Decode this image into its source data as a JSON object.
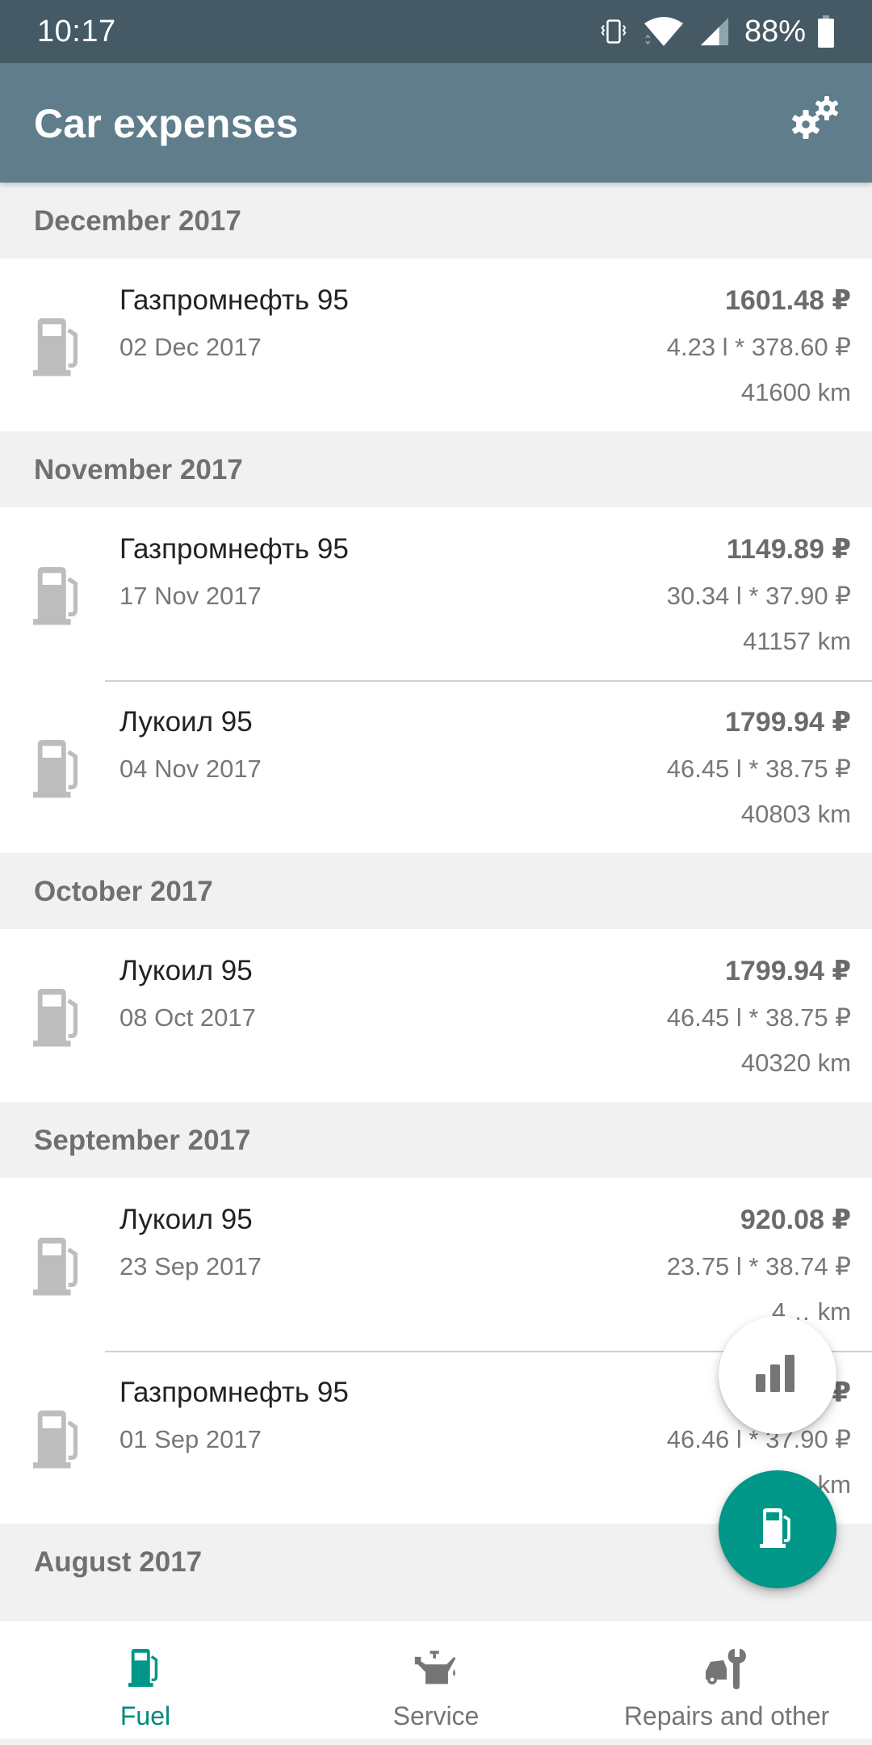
{
  "status_bar": {
    "time": "10:17",
    "battery_percent": "88%",
    "icons": [
      "vibrate-icon",
      "wifi-icon",
      "cell-signal-icon",
      "battery-icon"
    ]
  },
  "app_bar": {
    "title": "Car expenses",
    "action_icon": "settings-icon"
  },
  "sections": [
    {
      "header": "December 2017",
      "rows": [
        {
          "station": "Газпромнефть 95",
          "date": "02 Dec 2017",
          "amount": "1601.48 ₽",
          "calc": "4.23 l * 378.60 ₽",
          "odometer": "41600 km"
        }
      ]
    },
    {
      "header": "November 2017",
      "rows": [
        {
          "station": "Газпромнефть 95",
          "date": "17 Nov 2017",
          "amount": "1149.89 ₽",
          "calc": "30.34 l * 37.90 ₽",
          "odometer": "41157 km"
        },
        {
          "station": "Лукоил 95",
          "date": "04 Nov 2017",
          "amount": "1799.94 ₽",
          "calc": "46.45 l * 38.75 ₽",
          "odometer": "40803 km"
        }
      ]
    },
    {
      "header": "October 2017",
      "rows": [
        {
          "station": "Лукоил 95",
          "date": "08 Oct 2017",
          "amount": "1799.94 ₽",
          "calc": "46.45 l * 38.75 ₽",
          "odometer": "40320 km"
        }
      ]
    },
    {
      "header": "September 2017",
      "rows": [
        {
          "station": "Лукоил 95",
          "date": "23 Sep 2017",
          "amount": "920.08 ₽",
          "calc": "23.75 l * 38.74 ₽",
          "odometer": "4… km"
        },
        {
          "station": "Газпромнефть 95",
          "date": "01 Sep 2017",
          "amount": "17… ₽",
          "calc": "46.46 l * 37.90 ₽",
          "odometer": "… km"
        }
      ]
    },
    {
      "header": "August 2017",
      "rows": []
    }
  ],
  "fabs": {
    "stats": {
      "icon": "bar-chart-icon"
    },
    "add_fuel": {
      "icon": "fuel-pump-icon"
    }
  },
  "bottom_nav": {
    "items": [
      {
        "label": "Fuel",
        "icon": "fuel-pump-icon",
        "active": true
      },
      {
        "label": "Service",
        "icon": "oil-can-icon",
        "active": false
      },
      {
        "label": "Repairs and other",
        "icon": "car-wrench-icon",
        "active": false
      }
    ]
  },
  "colors": {
    "status_bar": "#455A64",
    "app_bar": "#607D8B",
    "accent": "#009688",
    "active_nav": "#00897B",
    "section_bg": "#F1F1F1",
    "icon_gray": "#BDBDBD"
  }
}
